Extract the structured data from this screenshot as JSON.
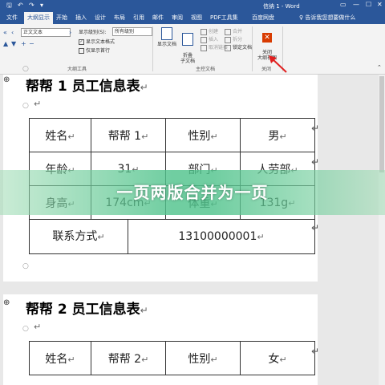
{
  "titlebar": {
    "doc_title": "信纳 1 - Word",
    "quick_access": {
      "save": "🖫",
      "undo": "↶",
      "redo": "↷",
      "customize": "▾"
    },
    "window": {
      "restore": "▭",
      "minimize": "—",
      "maximize": "☐",
      "close": "✕"
    }
  },
  "tabs": [
    "文件",
    "大纲显示",
    "开始",
    "插入",
    "设计",
    "布局",
    "引用",
    "邮件",
    "审阅",
    "视图",
    "PDF工具集",
    "百度网盘"
  ],
  "help": "♀ 告诉我您想要做什么",
  "ribbon": {
    "outline": {
      "level_select": "正文文本",
      "show_level_label": "显示级别(S):",
      "show_level_select": "所有级别",
      "show_text_format": "显示文本格式",
      "show_first_line": "仅显示首行",
      "group_label": "大纲工具"
    },
    "master": {
      "show_document": "显示文档",
      "collapse_subdoc": "折叠\n子文档",
      "create": "创建",
      "insert": "插入",
      "unlink": "取消链接",
      "merge": "合并",
      "split": "拆分",
      "lock": "锁定文档",
      "group_label": "主控文档"
    },
    "close": {
      "button": "关闭\n大纲视图",
      "group_label": "关闭"
    }
  },
  "doc": {
    "heading1": "帮帮 1 员工信息表",
    "heading2": "帮帮 2 员工信息表",
    "para_mark": "↵",
    "table1": {
      "row1": [
        "姓名",
        "帮帮 1",
        "性别",
        "男"
      ],
      "row2": [
        "年龄",
        "31",
        "部门",
        "人劳部"
      ],
      "row3": [
        "身高",
        "174cm",
        "体重",
        "131g"
      ],
      "row4": [
        "联系方式",
        "13100000001"
      ]
    },
    "table2": {
      "row1": [
        "姓名",
        "帮帮 2",
        "性别",
        "女"
      ]
    }
  },
  "overlay": "一页两版合并为一页"
}
